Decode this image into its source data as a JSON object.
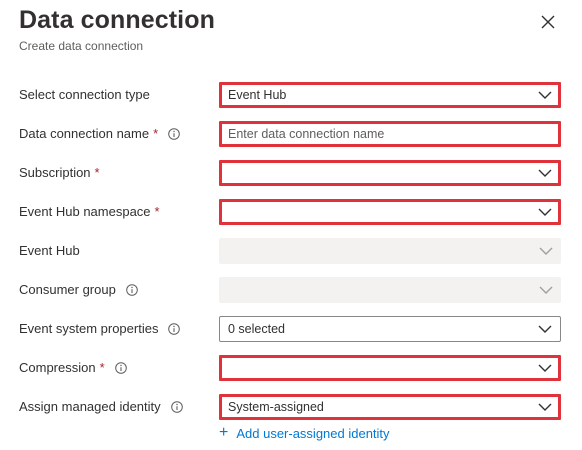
{
  "header": {
    "title": "Data connection",
    "subtitle": "Create data connection"
  },
  "fields": {
    "connection_type": {
      "label": "Select connection type",
      "value": "Event Hub"
    },
    "connection_name": {
      "label": "Data connection name",
      "placeholder": "Enter data connection name"
    },
    "subscription": {
      "label": "Subscription",
      "value": ""
    },
    "namespace": {
      "label": "Event Hub namespace",
      "value": ""
    },
    "event_hub": {
      "label": "Event Hub",
      "value": ""
    },
    "consumer_group": {
      "label": "Consumer group",
      "value": ""
    },
    "event_system_properties": {
      "label": "Event system properties",
      "value": "0 selected"
    },
    "compression": {
      "label": "Compression",
      "value": ""
    },
    "managed_identity": {
      "label": "Assign managed identity",
      "value": "System-assigned"
    }
  },
  "required_marker": "*",
  "add_identity_link": "Add user-assigned identity",
  "colors": {
    "highlight": "#e0323a",
    "required": "#a4262c",
    "link": "#0078d4",
    "disabled": "#f3f2f1"
  }
}
